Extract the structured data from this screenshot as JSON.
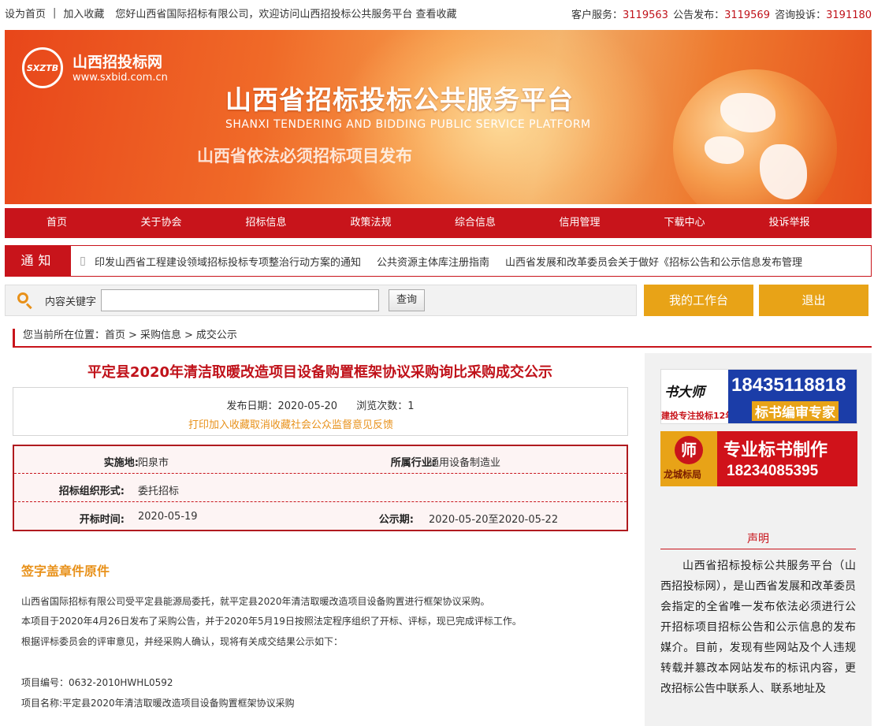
{
  "topbar": {
    "set_home": "设为首页",
    "separator": "|",
    "favorite": "加入收藏",
    "welcome": "您好山西省国际招标有限公司，欢迎访问山西招投标公共服务平台",
    "view_favorites": "查看收藏",
    "service_label": "客户服务：",
    "service_number": "3119563",
    "announce_label": "公告发布：",
    "announce_number": "3119569",
    "complaint_label": "咨询投诉：",
    "complaint_number": "3191180"
  },
  "banner": {
    "logo_text": "SXZTB",
    "site_name": "山西招投标网",
    "site_url": "www.sxbid.com.cn",
    "title": "山西省招标投标公共服务平台",
    "subtitle": "SHANXI TENDERING AND BIDDING PUBLIC SERVICE PLATFORM",
    "slogan": "山西省依法必须招标项目发布"
  },
  "nav": {
    "items": [
      "首页",
      "关于协会",
      "招标信息",
      "政策法规",
      "综合信息",
      "信用管理",
      "下载中心",
      "投诉举报"
    ]
  },
  "notice": {
    "label": "通知",
    "items": [
      "印发山西省工程建设领域招标投标专项整治行动方案的通知",
      "公共资源主体库注册指南",
      "山西省发展和改革委员会关于做好《招标公告和公示信息发布管理"
    ]
  },
  "search": {
    "label": "内容关键字",
    "value": "",
    "placeholder": "",
    "button": "查询",
    "workbench": "我的工作台",
    "logout": "退出"
  },
  "breadcrumb": {
    "prefix": "您当前所在位置：",
    "items": [
      "首页",
      "采购信息",
      "成交公示"
    ],
    "separator": ">"
  },
  "article": {
    "title": "平定县2020年清洁取暖改造项目设备购置框架协议采购询比采购成交公示",
    "publish_label": "发布日期：",
    "publish_date": "2020-05-20",
    "views_label": "浏览次数：",
    "views": "1",
    "actions": [
      "打印",
      "加入收藏",
      "取消收藏",
      "社会公众监督意见反馈"
    ],
    "info": {
      "location_label": "实施地:",
      "location": "阳泉市",
      "industry_label": "所属行业:",
      "industry": "通用设备制造业",
      "org_form_label": "招标组织形式:",
      "org_form": "委托招标",
      "open_time_label": "开标时间:",
      "open_time": "2020-05-19",
      "publicity_label": "公示期:",
      "publicity": "2020-05-20至2020-05-22"
    },
    "section_title": "签字盖章件原件",
    "paragraphs": [
      "山西省国际招标有限公司受平定县能源局委托，就平定县2020年清洁取暖改造项目设备购置进行框架协议采购。",
      "本项目于2020年4月26日发布了采购公告，并于2020年5月19日按照法定程序组织了开标、评标，现已完成评标工作。",
      "根据评标委员会的评审意见，并经采购人确认，现将有关成交结果公示如下：",
      "项目编号：0632-2010HWHL0592",
      "项目名称:平定县2020年清洁取暖改造项目设备购置框架协议采购"
    ]
  },
  "sidebar": {
    "ad1": {
      "brand": "书大师",
      "years": "建投专注投标12年",
      "phone": "18435118818",
      "tag": "标书编审专家"
    },
    "ad2": {
      "logo_char": "师",
      "logo_name": "龙城标局",
      "headline": "专业标书制作",
      "phone": "18234085395"
    },
    "declaration_title": "声明",
    "declaration_text": "山西省招标投标公共服务平台（山西招投标网），是山西省发展和改革委员会指定的全省唯一发布依法必须进行公开招标项目招标公告和公示信息的发布媒介。目前，发现有些网站及个人违规转载并篡改本网站发布的标讯内容，更改招标公告中联系人、联系地址及"
  },
  "colors": {
    "brand_red": "#c8141b",
    "accent_orange": "#e8911a",
    "gold_button": "#e8a317"
  }
}
